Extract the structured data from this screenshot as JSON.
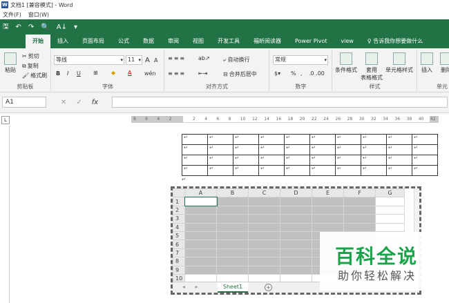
{
  "title": "文档1 [兼容模式] - Word",
  "app_icon": "W",
  "menu": [
    "文件(F)",
    "窗口(W)"
  ],
  "qat": {
    "save": "🖫",
    "undo": "↶",
    "redo": "↷",
    "preview": "🔍",
    "sort": "A↓",
    "more": "▾"
  },
  "tabs": [
    "开始",
    "插入",
    "页面布局",
    "公式",
    "数据",
    "审阅",
    "视图",
    "开发工具",
    "福昕阅读器",
    "Power Pivot",
    "view",
    "♀ 告诉我你想要做什么"
  ],
  "ribbon": {
    "clipboard": {
      "paste": "粘贴",
      "cut": "剪切",
      "copy": "复制",
      "format_painter": "格式刷",
      "label": "剪贴板"
    },
    "font": {
      "name": "等线",
      "size": "11",
      "grow": "A",
      "shrink": "A",
      "bold": "B",
      "italic": "I",
      "underline": "U",
      "wen": "wén",
      "label": "字体"
    },
    "alignment": {
      "wrap": "自动换行",
      "merge": "合并后居中",
      "label": "对齐方式"
    },
    "number": {
      "format": "常规",
      "percent": "%",
      "comma": ",",
      "label": "数字"
    },
    "styles": {
      "conditional": "条件格式",
      "table_format": "套用\n表格格式",
      "cell_styles": "单元格样式",
      "label": "样式"
    },
    "cells": {
      "insert": "插入",
      "delete": "删除",
      "label": "单元"
    }
  },
  "formula_bar": {
    "name_box": "A1",
    "cancel": "✕",
    "enter": "✓",
    "fx": "fx",
    "value": ""
  },
  "ruler": {
    "ticks": [
      "8",
      "6",
      "4",
      "2",
      "",
      "2",
      "4",
      "6",
      "8",
      "10",
      "12",
      "14",
      "16",
      "18",
      "20",
      "22",
      "24",
      "26",
      "28",
      "30",
      "32",
      "34",
      "36",
      "38",
      "40",
      "42"
    ]
  },
  "ruler_button": "L",
  "word_table": {
    "rows": 4,
    "cols": 10,
    "mark": "↵"
  },
  "para_mark": "↵",
  "excel": {
    "columns": [
      "A",
      "B",
      "C",
      "D",
      "E",
      "F",
      "G"
    ],
    "rows": [
      "1",
      "2",
      "3",
      "4",
      "5",
      "6",
      "7",
      "8",
      "9",
      "10"
    ],
    "sheet_tab": "Sheet1",
    "add_sheet": "+",
    "nav_arrows": "◂ ▸"
  },
  "watermark": {
    "line1": "百科全说",
    "line2": "助你轻松解决"
  }
}
